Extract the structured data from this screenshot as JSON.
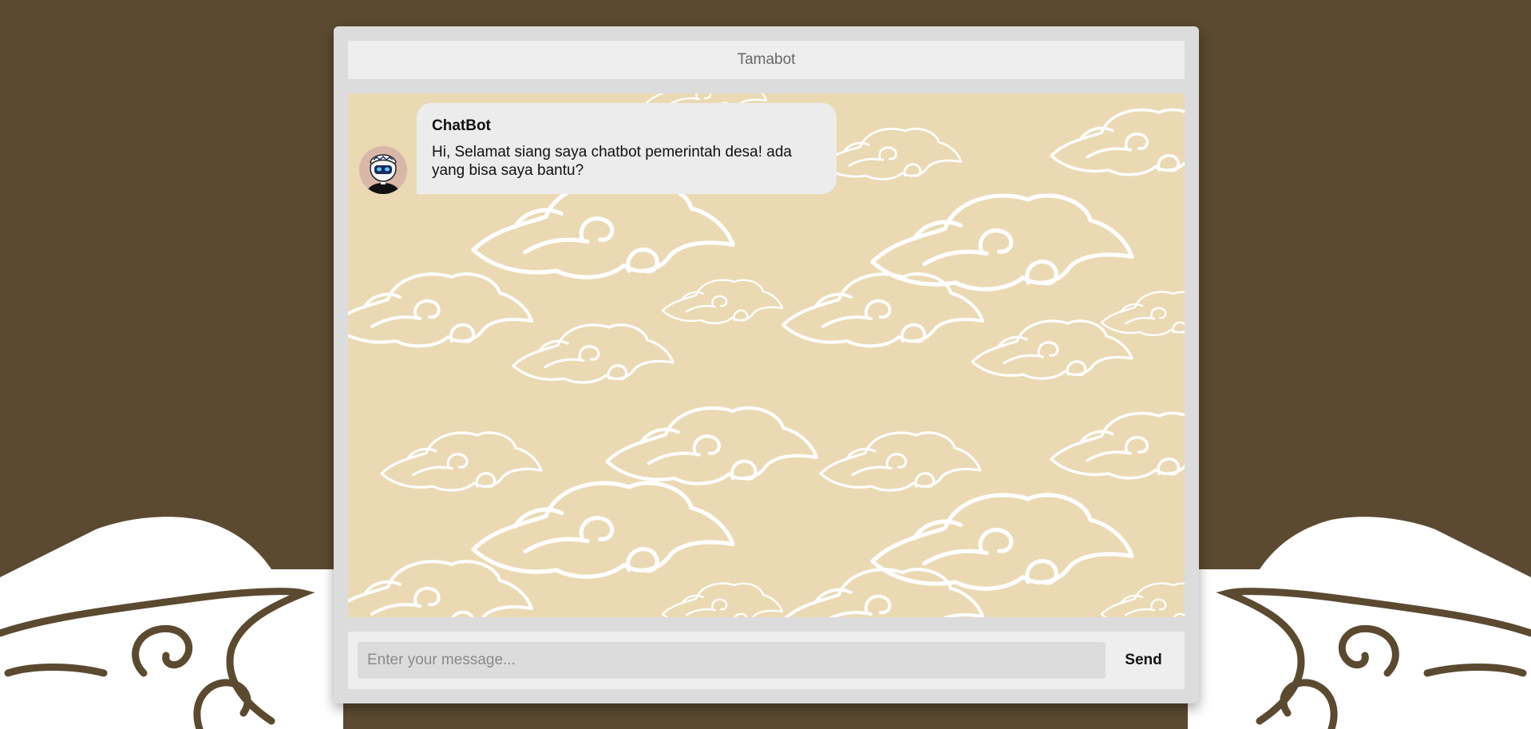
{
  "header": {
    "title": "Tamabot"
  },
  "messages": [
    {
      "sender": "ChatBot",
      "text": "Hi, Selamat siang saya chatbot pemerintah desa! ada yang bisa saya bantu?"
    }
  ],
  "input": {
    "placeholder": "Enter your message...",
    "value": ""
  },
  "send_button": {
    "label": "Send"
  },
  "colors": {
    "page_background": "#5b4a30",
    "chat_background": "#ead9b3",
    "cloud": "#ffffff",
    "panel": "#eeeeee"
  },
  "icons": {
    "avatar": "bot-avatar-icon",
    "background_clouds": "mega-mendung-cloud-icon"
  }
}
